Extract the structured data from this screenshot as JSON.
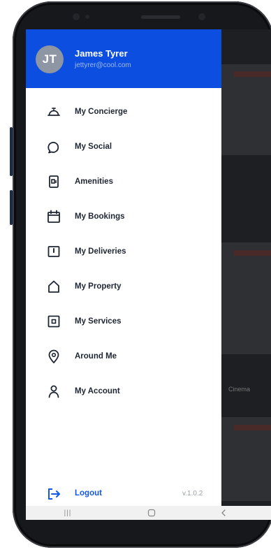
{
  "user": {
    "initials": "JT",
    "name": "James Tyrer",
    "email": "jettyrer@cool.com"
  },
  "menu": {
    "items": [
      {
        "label": "My Concierge",
        "icon": "concierge-bell-icon"
      },
      {
        "label": "My Social",
        "icon": "chat-bubble-icon"
      },
      {
        "label": "Amenities",
        "icon": "amenities-icon"
      },
      {
        "label": "My Bookings",
        "icon": "calendar-icon"
      },
      {
        "label": "My Deliveries",
        "icon": "delivery-box-icon"
      },
      {
        "label": "My Property",
        "icon": "house-icon"
      },
      {
        "label": "My Services",
        "icon": "services-icon"
      },
      {
        "label": "Around Me",
        "icon": "location-pin-icon"
      },
      {
        "label": "My Account",
        "icon": "person-icon"
      }
    ],
    "logout_label": "Logout",
    "version": "v.1.0.2"
  },
  "background": {
    "text_1": "Cinema"
  },
  "colors": {
    "header": "#0c4fe0",
    "accent": "#1457e6",
    "label": "#1f2633"
  },
  "navbar": {
    "recents": "|||"
  }
}
